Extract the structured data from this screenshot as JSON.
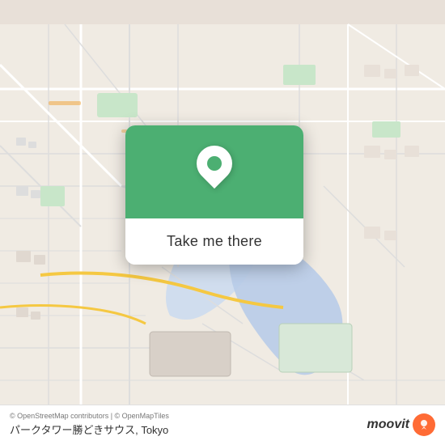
{
  "map": {
    "background_color": "#e8e0d8",
    "popup": {
      "button_label": "Take me there",
      "pin_color": "#4caf72",
      "pin_inner_color": "#4caf72"
    }
  },
  "bottom_bar": {
    "attribution": "© OpenStreetMap contributors | © OpenMapTiles",
    "location_name": "パークタワー勝どきサウス, Tokyo",
    "moovit_label": "moovit"
  }
}
